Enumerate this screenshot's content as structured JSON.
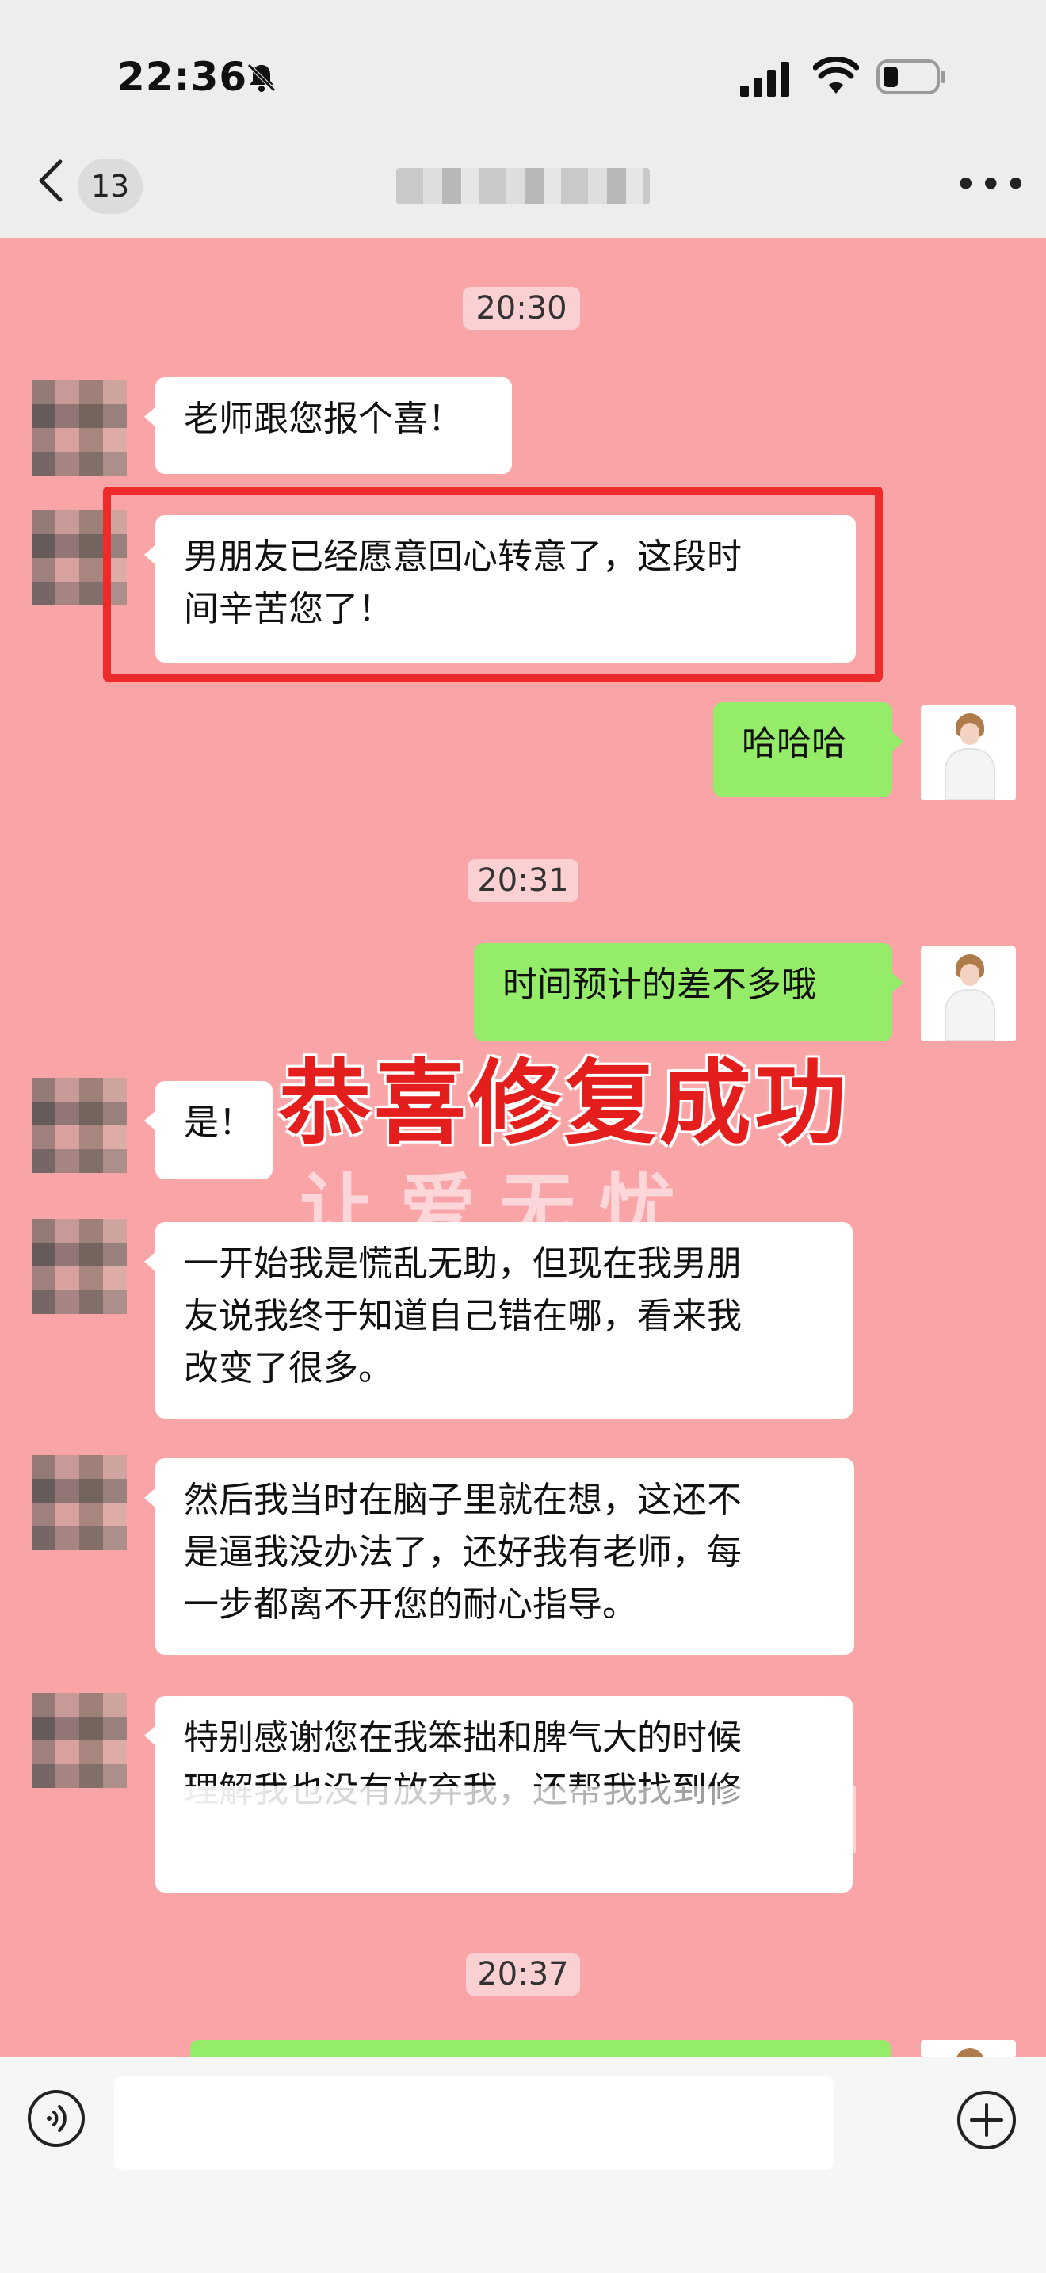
{
  "status_bar": {
    "time": "22:36",
    "icons": [
      "bell-slash-icon",
      "signal-icon",
      "wifi-icon",
      "battery-icon"
    ]
  },
  "header": {
    "back_icon": "chevron-left-icon",
    "unread_count": "13",
    "contact_name": "████ ██████",
    "more_icon": "more-dots-icon"
  },
  "messages": [
    {
      "type": "timestamp",
      "text": "20:30"
    },
    {
      "type": "in",
      "lines": [
        "老师跟您报个喜！"
      ]
    },
    {
      "type": "in",
      "highlighted": true,
      "lines": [
        "男朋友已经愿意回心转意了，这段时",
        "间辛苦您了！"
      ]
    },
    {
      "type": "out",
      "lines": [
        "哈哈哈"
      ]
    },
    {
      "type": "timestamp",
      "text": "20:31"
    },
    {
      "type": "out",
      "lines": [
        "时间预计的差不多哦"
      ]
    },
    {
      "type": "in",
      "lines": [
        "是！"
      ]
    },
    {
      "type": "in",
      "lines": [
        "一开始我是慌乱无助，但现在我男朋",
        "友说我终于知道自己错在哪，看来我",
        "改变了很多。"
      ]
    },
    {
      "type": "in",
      "lines": [
        "然后我当时在脑子里就在想，这还不",
        "是逼我没办法了，还好我有老师，每",
        "一步都离不开您的耐心指导。"
      ]
    },
    {
      "type": "in",
      "lines": [
        "特别感谢您在我笨拙和脾气大的时候",
        "理解我也没有放弃我，还帮我找到修"
      ]
    },
    {
      "type": "timestamp",
      "text": "20:37"
    }
  ],
  "overlay": {
    "headline": "恭喜修复成功",
    "watermark": "让爱无忧"
  },
  "input_bar": {
    "voice_icon": "voice-icon",
    "input_value": "",
    "plus_icon": "plus-circle-icon"
  },
  "colors": {
    "chat_bg": "#f9a5a8",
    "bubble_out": "#95ec69",
    "bubble_in": "#ffffff",
    "highlight": "#ee2a2a",
    "headline": "#e41d1d"
  }
}
